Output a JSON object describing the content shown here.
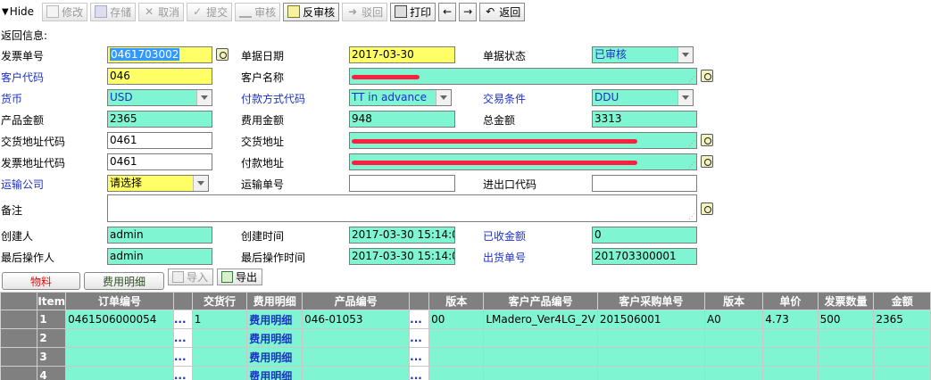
{
  "toolbar": {
    "hide_label": "Hide",
    "edit": "修改",
    "save": "存储",
    "cancel": "取消",
    "submit": "提交",
    "audit": "审核",
    "unaudit": "反审核",
    "reject": "驳回",
    "print": "打印",
    "prev": "←",
    "next": "→",
    "back": "返回"
  },
  "return_info_label": "返回信息:",
  "form": {
    "invoice_no": {
      "label": "发票单号",
      "value": "0461703002"
    },
    "doc_date": {
      "label": "单据日期",
      "value": "2017-03-30"
    },
    "doc_status": {
      "label": "单据状态",
      "value": "已审核"
    },
    "customer_code": {
      "label": "客户代码",
      "value": "046"
    },
    "customer_name": {
      "label": "客户名称",
      "value": ""
    },
    "currency": {
      "label": "货币",
      "value": "USD"
    },
    "payment_method_code": {
      "label": "付款方式代码",
      "value": "TT in advance"
    },
    "trade_terms": {
      "label": "交易条件",
      "value": "DDU"
    },
    "product_amount": {
      "label": "产品金额",
      "value": "2365"
    },
    "fee_amount": {
      "label": "费用金额",
      "value": "948"
    },
    "total_amount": {
      "label": "总金额",
      "value": "3313"
    },
    "delivery_addr_code": {
      "label": "交货地址代码",
      "value": "0461"
    },
    "delivery_addr": {
      "label": "交货地址",
      "value": ""
    },
    "invoice_addr_code": {
      "label": "发票地址代码",
      "value": "0461"
    },
    "payment_addr": {
      "label": "付款地址",
      "value": ""
    },
    "shipping_company": {
      "label": "运输公司",
      "value": "请选择"
    },
    "shipping_no": {
      "label": "运输单号",
      "value": ""
    },
    "import_export_code": {
      "label": "进出口代码",
      "value": ""
    },
    "remarks": {
      "label": "备注",
      "value": ""
    },
    "creator": {
      "label": "创建人",
      "value": "admin"
    },
    "created_time": {
      "label": "创建时间",
      "value": "2017-03-30 15:14:00"
    },
    "received_amount": {
      "label": "已收金额",
      "value": "0"
    },
    "last_operator": {
      "label": "最后操作人",
      "value": "admin"
    },
    "last_op_time": {
      "label": "最后操作时间",
      "value": "2017-03-30 15:14:00"
    },
    "shipment_no": {
      "label": "出货单号",
      "value": "201703300001"
    }
  },
  "tabs": {
    "materials": "物料",
    "fee_detail": "费用明细"
  },
  "grid_buttons": {
    "import": "导入",
    "export": "导出"
  },
  "grid": {
    "columns": [
      "Item",
      "订单编号",
      "",
      "交货行",
      "费用明细",
      "产品编号",
      "",
      "版本",
      "客户产品编号",
      "客户采购单号",
      "版本",
      "单价",
      "发票数量",
      "金额"
    ],
    "rows": [
      {
        "item": "1",
        "order_no": "0461506000054",
        "dots1": "...",
        "line": "1",
        "fee": "费用明细",
        "product_no": "046-01053",
        "dots2": "...",
        "version": "00",
        "cust_product_no": "LMadero_Ver4LG_2V",
        "cust_po": "201506001",
        "version2": "A0",
        "price": "4.73",
        "qty": "500",
        "amount": "2365"
      },
      {
        "item": "2",
        "order_no": "",
        "dots1": "...",
        "line": "",
        "fee": "费用明细",
        "product_no": "",
        "dots2": "...",
        "version": "",
        "cust_product_no": "",
        "cust_po": "",
        "version2": "",
        "price": "",
        "qty": "",
        "amount": ""
      },
      {
        "item": "3",
        "order_no": "",
        "dots1": "...",
        "line": "",
        "fee": "费用明细",
        "product_no": "",
        "dots2": "...",
        "version": "",
        "cust_product_no": "",
        "cust_po": "",
        "version2": "",
        "price": "",
        "qty": "",
        "amount": ""
      },
      {
        "item": "4",
        "order_no": "",
        "dots1": "...",
        "line": "",
        "fee": "费用明细",
        "product_no": "",
        "dots2": "...",
        "version": "",
        "cust_product_no": "",
        "cust_po": "",
        "version2": "",
        "price": "",
        "qty": "",
        "amount": ""
      }
    ]
  },
  "colors": {
    "mint": "#7ff5d2",
    "yellow": "#ffff66",
    "blue_label": "#1c32c7",
    "grid_header": "#808080"
  }
}
